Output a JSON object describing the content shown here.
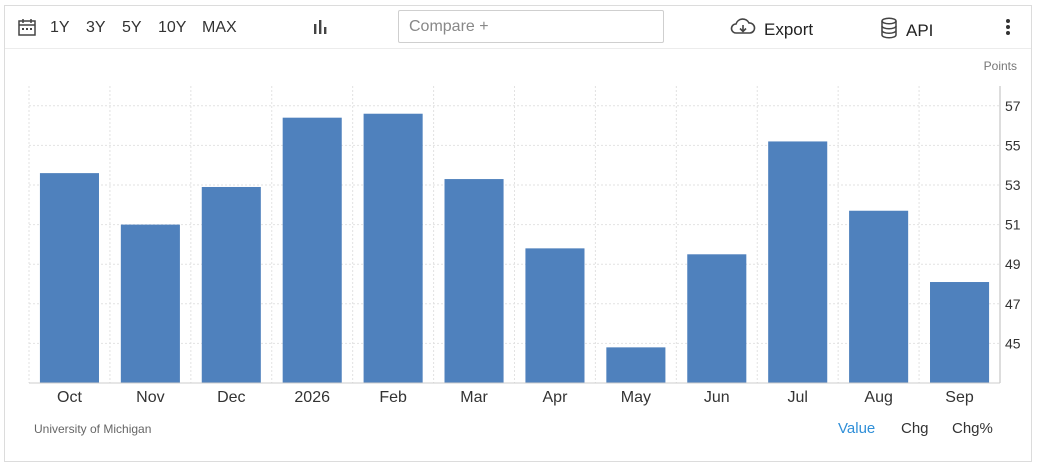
{
  "toolbar": {
    "ranges": [
      "1Y",
      "3Y",
      "5Y",
      "10Y",
      "MAX"
    ],
    "compare_placeholder": "Compare +",
    "export_label": "Export",
    "api_label": "API",
    "icons": [
      "calendar-icon",
      "bar-chart-icon",
      "cloud-download-icon",
      "database-icon",
      "more-vertical-icon"
    ]
  },
  "chart_units": "Points",
  "source": "University of Michigan",
  "view_tabs": {
    "value": "Value",
    "chg": "Chg",
    "chgpct": "Chg%",
    "active": "Value"
  },
  "colors": {
    "bar": "#4f81bd",
    "active_tab": "#2f8fd8",
    "grid": "#e2e2e2"
  },
  "chart_data": {
    "type": "bar",
    "categories": [
      "Oct",
      "Nov",
      "Dec",
      "2026",
      "Feb",
      "Mar",
      "Apr",
      "May",
      "Jun",
      "Jul",
      "Aug",
      "Sep"
    ],
    "values": [
      53.6,
      51.0,
      52.9,
      56.4,
      56.6,
      53.3,
      49.8,
      44.8,
      49.5,
      55.2,
      51.7,
      48.1
    ],
    "y_ticks": [
      45,
      47,
      49,
      51,
      53,
      55,
      57
    ],
    "ylim": [
      43,
      58
    ],
    "ylabel": "Points",
    "grid": true
  }
}
